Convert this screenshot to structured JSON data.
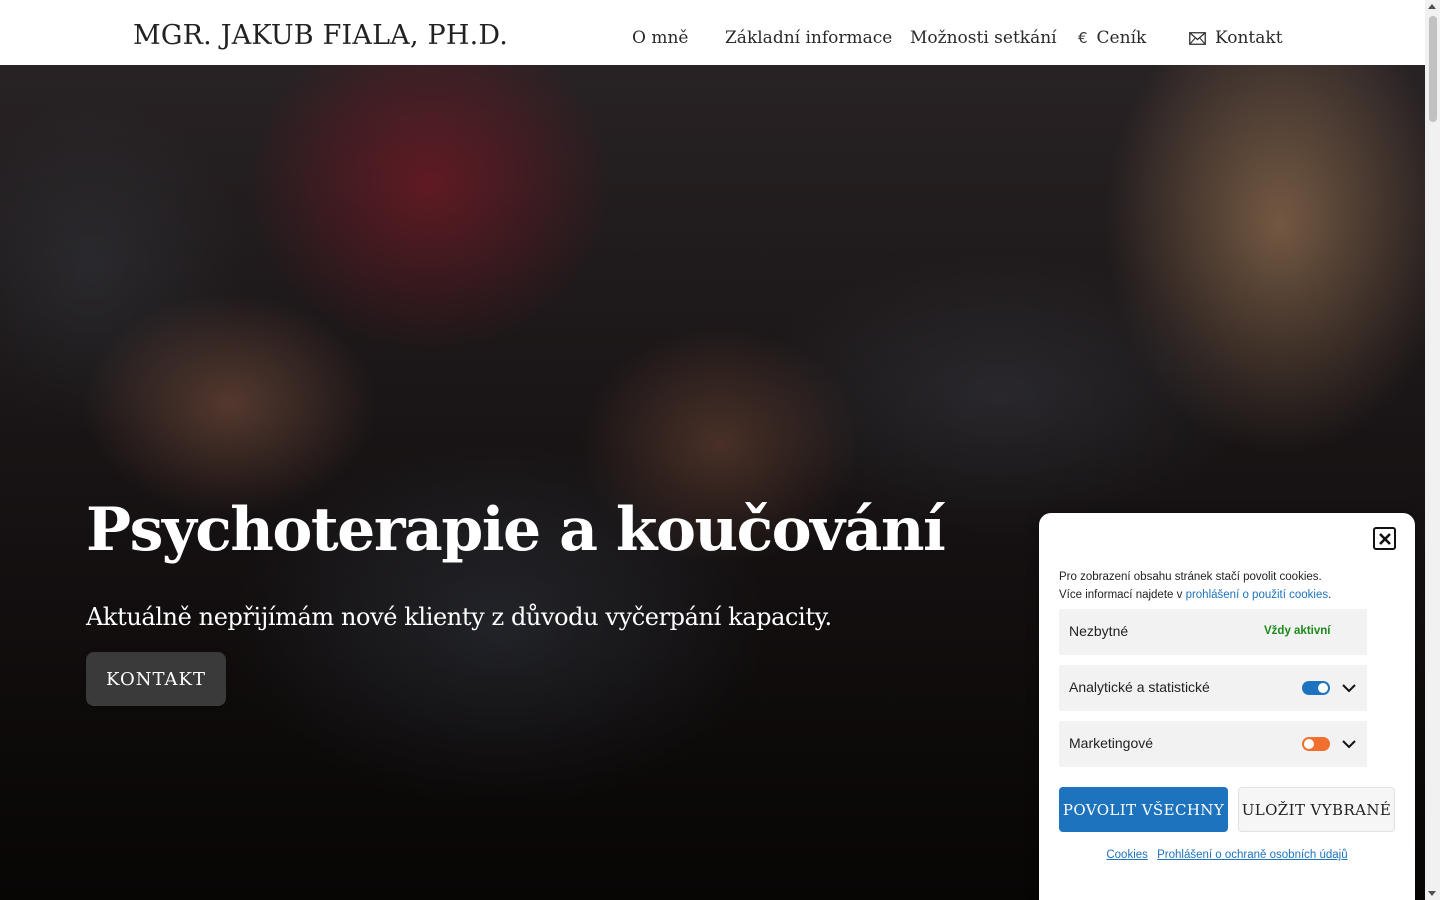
{
  "header": {
    "site_title": "MGR. JAKUB FIALA, PH.D.",
    "nav": [
      {
        "label": "O mně",
        "icon": null
      },
      {
        "label": "Základní informace",
        "icon": null
      },
      {
        "label": "Možnosti setkání",
        "icon": null
      },
      {
        "label": "Ceník",
        "icon": "euro-icon",
        "icon_glyph": "€"
      },
      {
        "label": "Kontakt",
        "icon": "envelope-icon"
      }
    ]
  },
  "hero": {
    "heading": "Psychoterapie a koučování",
    "subheading": "Aktuálně nepřijímám nové klienty z důvodu vyčerpání kapacity.",
    "button_label": "KONTAKT"
  },
  "cookie_banner": {
    "text_line1": "Pro zobrazení obsahu stránek stačí povolit cookies.",
    "text_line2_prefix": "Více informací najdete v ",
    "text_line2_link": "prohlášení o použití cookies",
    "text_line2_suffix": ".",
    "categories": [
      {
        "label": "Nezbytné",
        "status": "Vždy aktivní"
      },
      {
        "label": "Analytické a statistické",
        "enabled": true,
        "toggle_color": "#1e73be"
      },
      {
        "label": "Marketingové",
        "enabled": false,
        "toggle_color": "#f07030"
      }
    ],
    "accept_all_label": "POVOLIT VŠECHNY",
    "save_selected_label": "ULOŽIT VYBRANÉ",
    "footer_links": [
      "Cookies",
      "Prohlášení o ochraně osobních údajů"
    ]
  },
  "colors": {
    "accent": "#1e73be",
    "always_active": "#1a8a1a",
    "marketing_toggle": "#f07030",
    "hero_button": "#3a3a3a"
  }
}
